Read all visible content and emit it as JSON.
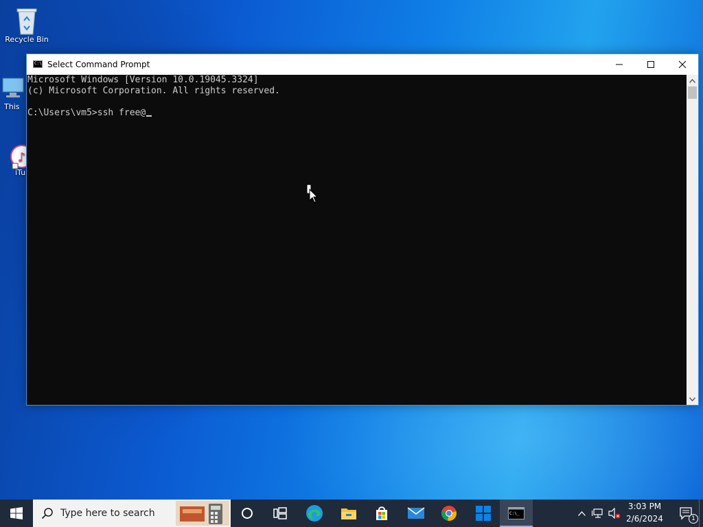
{
  "desktop": {
    "icons": [
      {
        "label": "Recycle Bin",
        "icon": "recycle-bin-icon"
      },
      {
        "label": "This",
        "icon": "this-pc-icon"
      },
      {
        "label": "iTu",
        "icon": "itunes-icon"
      }
    ]
  },
  "window": {
    "title": "Select Command Prompt",
    "icon": "command-prompt-icon",
    "controls": [
      "minimize-icon",
      "maximize-icon",
      "close-icon"
    ],
    "console_lines": [
      "Microsoft Windows [Version 10.0.19045.3324]",
      "(c) Microsoft Corporation. All rights reserved.",
      "",
      "C:\\Users\\vm5>ssh free@"
    ]
  },
  "taskbar": {
    "search_placeholder": "Type here to search",
    "apps": [
      "start-icon",
      "cortana-icon",
      "task-view-icon",
      "edge-icon",
      "file-explorer-icon",
      "microsoft-store-icon",
      "mail-icon",
      "chrome-icon",
      "start-tiles-icon",
      "command-prompt-icon"
    ],
    "clock_time": "3:03 PM",
    "clock_date": "2/6/2024",
    "notification_count": "1",
    "accent": "#0078d7"
  }
}
